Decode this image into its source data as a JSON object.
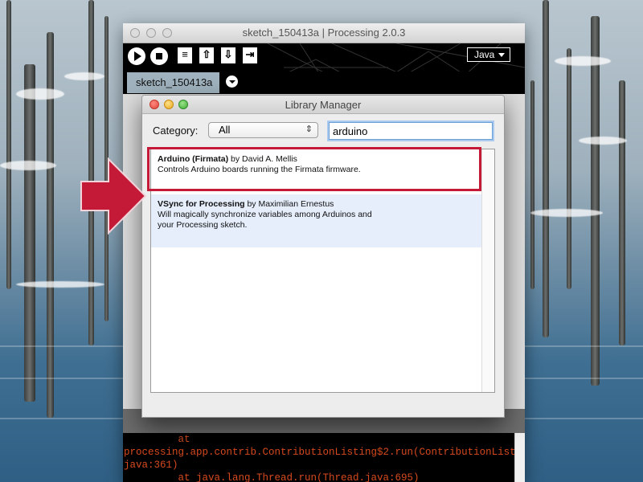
{
  "processing_window": {
    "title": "sketch_150413a | Processing 2.0.3",
    "mode_label": "Java",
    "tab_label": "sketch_150413a",
    "toolbar_icons": [
      "play-icon",
      "stop-icon",
      "new-icon",
      "open-icon",
      "save-icon",
      "export-icon"
    ]
  },
  "console": {
    "lines": [
      "         at",
      "processing.app.contrib.ContributionListing$2.run(ContributionListing.",
      "java:361)",
      "         at java.lang.Thread.run(Thread.java:695)"
    ],
    "text_color": "#d74a1f"
  },
  "library_manager": {
    "title": "Library Manager",
    "category_label": "Category:",
    "category_value": "All",
    "search_value": "arduino",
    "libraries": [
      {
        "name": "Arduino (Firmata)",
        "by_author": " by David A. Mellis",
        "description_lines": [
          "Controls Arduino boards running the Firmata firmware."
        ]
      },
      {
        "name": "VSync for Processing",
        "by_author": " by Maximilian Ernestus",
        "description_lines": [
          "Will magically synchronize variables among Arduinos and",
          "your Processing sketch."
        ]
      }
    ]
  },
  "annotation": {
    "highlight_color": "#c41a37"
  }
}
